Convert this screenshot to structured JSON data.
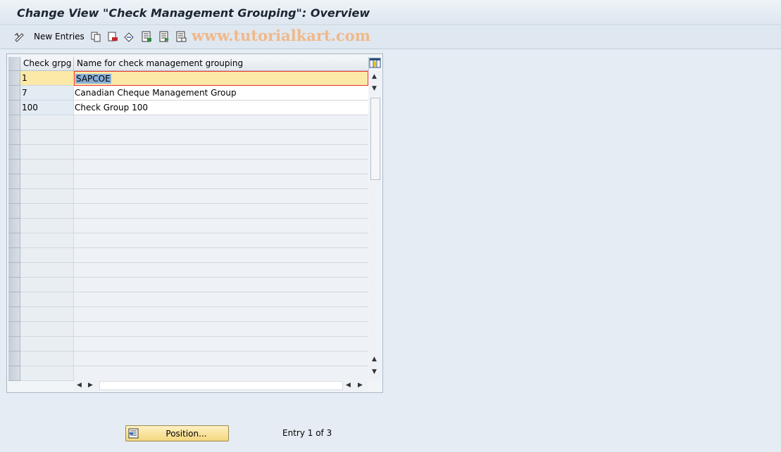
{
  "window": {
    "title": "Change View \"Check Management Grouping\": Overview"
  },
  "toolbar": {
    "new_entries_label": "New Entries",
    "watermark": "www.tutorialkart.com",
    "icons": [
      "display-change-icon",
      "copy-icon",
      "delete-icon",
      "undo-icon",
      "select-all-icon",
      "select-block-icon",
      "deselect-all-icon"
    ]
  },
  "table": {
    "columns": [
      "Check grpg",
      "Name for check management grouping"
    ],
    "rows": [
      {
        "grpg": "1",
        "name": "SAPCOE"
      },
      {
        "grpg": "7",
        "name": "Canadian Cheque Management Group"
      },
      {
        "grpg": "100",
        "name": "Check Group 100"
      }
    ],
    "empty_rows": 18,
    "selected_row": 0
  },
  "footer": {
    "position_label": "Position...",
    "entry_info": "Entry 1 of 3"
  },
  "colors": {
    "background": "#e6ecf3",
    "selected_row": "#fce9a8",
    "button": "#f4d77e"
  }
}
